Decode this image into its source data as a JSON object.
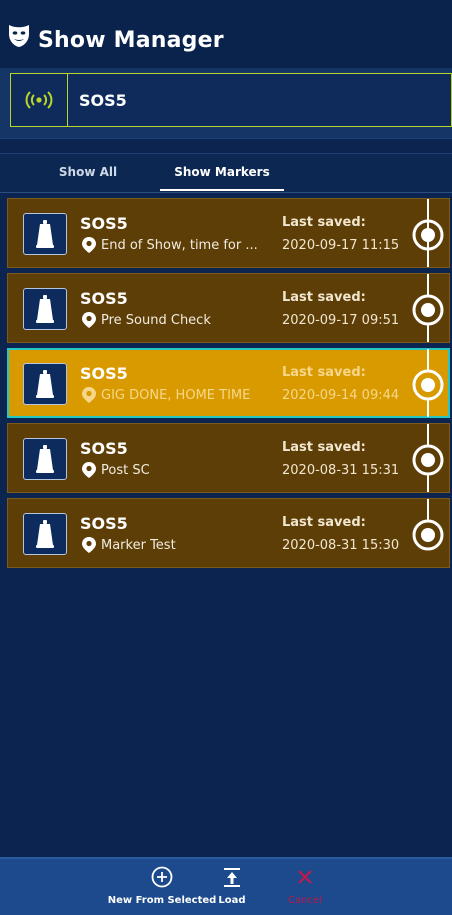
{
  "header": {
    "title": "Show Manager",
    "icon": "theatre-masks-icon"
  },
  "device": {
    "name": "SOS5",
    "icon": "wireless-signal-icon",
    "accent": "#b9d629"
  },
  "tabs": [
    {
      "label": "Show All",
      "active": false
    },
    {
      "label": "Show Markers",
      "active": true
    }
  ],
  "shows": [
    {
      "name": "SOS5",
      "marker": "End of Show, time for ...",
      "saved_label": "Last saved:",
      "saved_time": "2020-09-17 11:15",
      "selected": false
    },
    {
      "name": "SOS5",
      "marker": "Pre Sound Check",
      "saved_label": "Last saved:",
      "saved_time": "2020-09-17 09:51",
      "selected": false
    },
    {
      "name": "SOS5",
      "marker": "GIG DONE, HOME TIME",
      "saved_label": "Last saved:",
      "saved_time": "2020-09-14 09:44",
      "selected": true
    },
    {
      "name": "SOS5",
      "marker": "Post SC",
      "saved_label": "Last saved:",
      "saved_time": "2020-08-31 15:31",
      "selected": false
    },
    {
      "name": "SOS5",
      "marker": "Marker Test",
      "saved_label": "Last saved:",
      "saved_time": "2020-08-31 15:30",
      "selected": false
    }
  ],
  "actions": {
    "new_from_selected": "New From Selected",
    "load": "Load",
    "cancel": "Cancel"
  },
  "colors": {
    "background": "#0b2550",
    "row": "#5e3e07",
    "row_selected": "#d99a00",
    "selected_border": "#26c7c2",
    "cancel": "#c0194a"
  }
}
